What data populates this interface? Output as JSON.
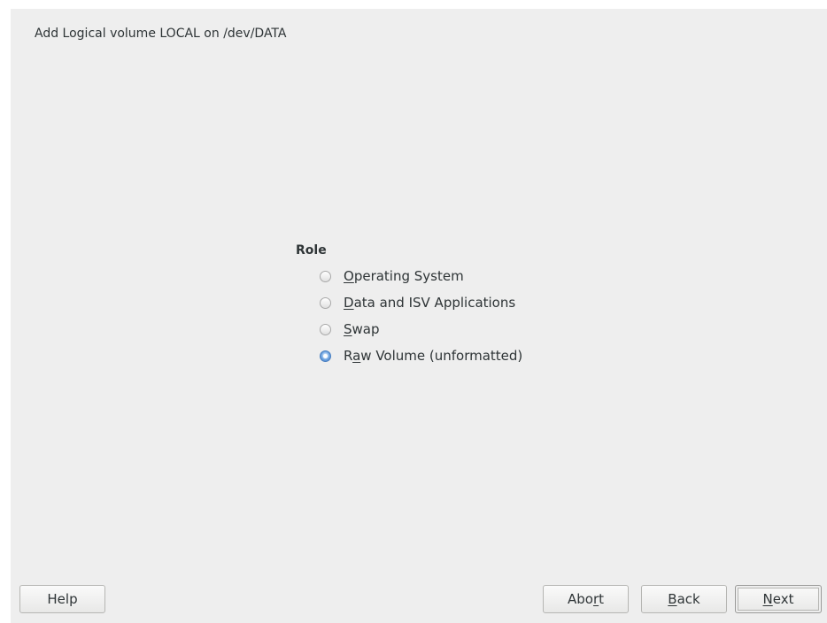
{
  "dialog": {
    "title": "Add Logical volume LOCAL on /dev/DATA"
  },
  "role": {
    "label": "Role",
    "options": [
      {
        "pre": "",
        "mnemonic": "O",
        "post": "perating System",
        "selected": false
      },
      {
        "pre": "",
        "mnemonic": "D",
        "post": "ata and ISV Applications",
        "selected": false
      },
      {
        "pre": "",
        "mnemonic": "S",
        "post": "wap",
        "selected": false
      },
      {
        "pre": "R",
        "mnemonic": "a",
        "post": "w Volume (unformatted)",
        "selected": true
      }
    ]
  },
  "buttons": {
    "help": {
      "pre": "Help",
      "mnemonic": "",
      "post": ""
    },
    "abort": {
      "pre": "Abo",
      "mnemonic": "r",
      "post": "t"
    },
    "back": {
      "pre": "",
      "mnemonic": "B",
      "post": "ack"
    },
    "next": {
      "pre": "",
      "mnemonic": "N",
      "post": "ext"
    }
  },
  "colors": {
    "window_background": "#eeeeee",
    "selected_radio": "#4a7fc1",
    "text": "#2e3436"
  }
}
